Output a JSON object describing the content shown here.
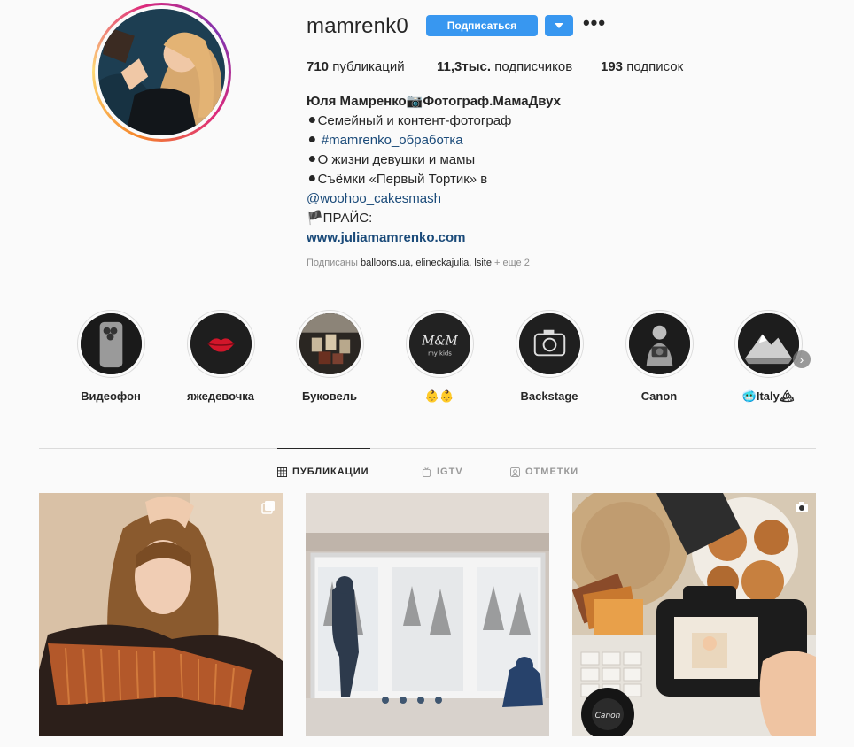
{
  "profile": {
    "username": "mamrenk0",
    "follow_label": "Подписаться",
    "more_label": "•••",
    "stats": {
      "posts_count": "710",
      "posts_label": "публикаций",
      "followers_count": "11,3тыс.",
      "followers_label": "подписчиков",
      "following_count": "193",
      "following_label": "подписок"
    },
    "bio": {
      "name": "Юля Мамренко📷Фотограф.МамаДвух",
      "line1": "⚫Семейный и контент-фотограф",
      "line2_prefix": "⚫ ",
      "line2_tag": "#mamrenko_обработка",
      "line3": "⚫О жизни девушки и мамы",
      "line4": "⚫Съёмки «Первый Тортик» в",
      "line5_mention": "@woohoo_cakesmash",
      "line6": "🏴ПРАЙС:",
      "website": "www.juliamamrenko.com"
    },
    "followed_by": {
      "prefix": "Подписаны",
      "names": "balloons.ua, elineckajulia, lsite",
      "more": "+ еще 2"
    }
  },
  "highlights": [
    {
      "label": "Видеофон",
      "icon": "phone-icon"
    },
    {
      "label": "яжедевочка",
      "icon": "lips-icon"
    },
    {
      "label": "Буковель",
      "icon": "cups-icon"
    },
    {
      "label": "👶👶",
      "icon": "monogram-icon"
    },
    {
      "label": "Backstage",
      "icon": "camera-icon"
    },
    {
      "label": "Canon",
      "icon": "photographer-icon"
    },
    {
      "label": "🥶Italy🏔",
      "icon": "mountain-icon"
    }
  ],
  "tabs": [
    {
      "label": "ПУБЛИКАЦИИ",
      "icon": "grid-icon",
      "active": true
    },
    {
      "label": "IGTV",
      "icon": "igtv-icon",
      "active": false
    },
    {
      "label": "ОТМЕТКИ",
      "icon": "tagged-icon",
      "active": false
    }
  ],
  "posts": [
    {
      "name": "post-woman-fringe-jacket",
      "badge": "carousel-icon"
    },
    {
      "name": "post-kids-window-snow",
      "badge": ""
    },
    {
      "name": "post-camera-cookies",
      "badge": "camera-icon"
    }
  ],
  "colors": {
    "accent": "#3897f0",
    "link": "#1a4a79",
    "muted": "#8e8e8e",
    "text": "#262626",
    "background": "#fafafa"
  }
}
